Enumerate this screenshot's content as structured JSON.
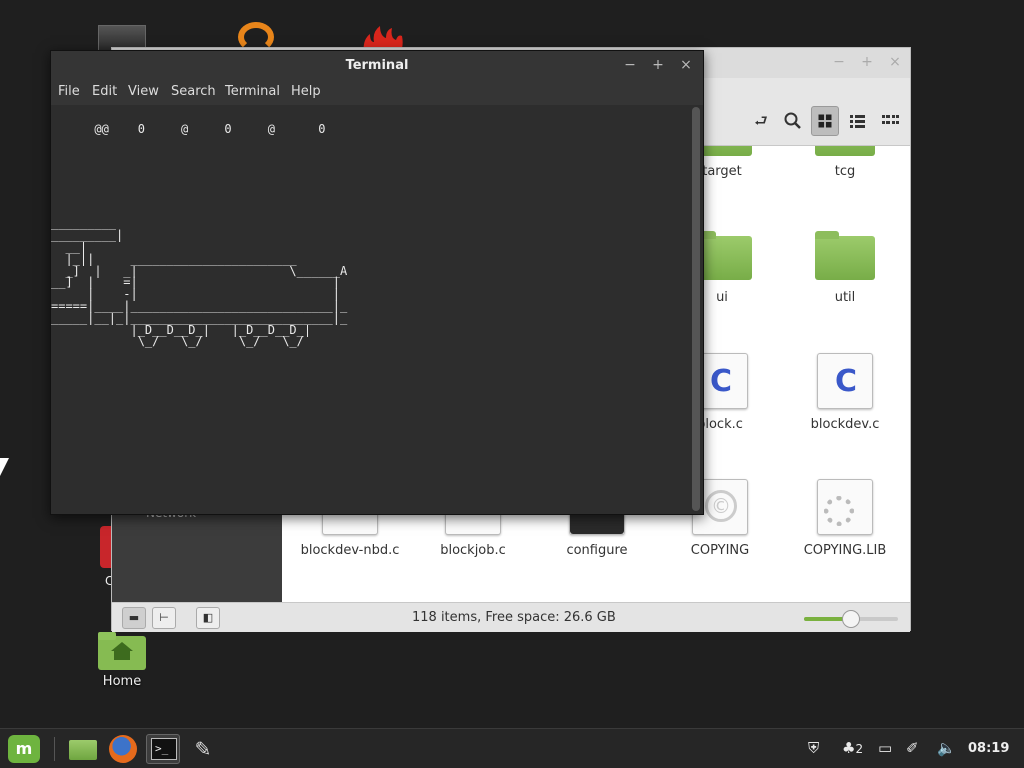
{
  "desktop": {
    "partial_label": "C",
    "home_label": "Home"
  },
  "file_manager": {
    "window_buttons": {
      "minimize": "−",
      "maximize": "+",
      "close": "×"
    },
    "toolbar_icons": [
      "toggle-location-icon",
      "search-icon",
      "icon-view-icon",
      "list-view-icon",
      "compact-view-icon"
    ],
    "sidebar_network_label": "Network",
    "items": [
      {
        "label": "target",
        "type": "folder"
      },
      {
        "label": "tcg",
        "type": "folder"
      },
      {
        "label": "ui",
        "type": "folder"
      },
      {
        "label": "util",
        "type": "folder"
      },
      {
        "label": "block.c",
        "type": "c-source"
      },
      {
        "label": "blockdev.c",
        "type": "c-source"
      },
      {
        "label": "blockdev-nbd.c",
        "type": "c-source"
      },
      {
        "label": "blockjob.c",
        "type": "c-source"
      },
      {
        "label": "configure",
        "type": "script"
      },
      {
        "label": "COPYING",
        "type": "license"
      },
      {
        "label": "COPYING.LIB",
        "type": "license"
      }
    ],
    "status_text": "118 items, Free space: 26.6 GB",
    "zoom_level": 0.5
  },
  "terminal": {
    "title": "Terminal",
    "window_buttons": {
      "minimize": "−",
      "maximize": "+",
      "close": "×"
    },
    "menu": [
      "File",
      "Edit",
      "View",
      "Search",
      "Terminal",
      "Help"
    ],
    "output": "      @@    0     @     0     @      0\n\n\n\n\n\n\n\n_________\n_________|\n  __|\n  |_||     _______________________\n  _]  |   _|                     \\______A\n__]  |    =|                           |\n     |    -|                           |\n=====|____|____________________________|_\n_____|__|_|____________________________|_\n           |_D__D__D_|   |_D__D__D_|\n            \\_/   \\_/     \\_/   \\_/"
  },
  "taskbar": {
    "menu_letter": "m",
    "terminal_glyph": ">_",
    "notification_count": "2",
    "clock": "08:19"
  },
  "colors": {
    "accent_green": "#7ab13f",
    "terminal_bg": "#2d2d2d",
    "desktop_bg": "#1f1f1f"
  }
}
